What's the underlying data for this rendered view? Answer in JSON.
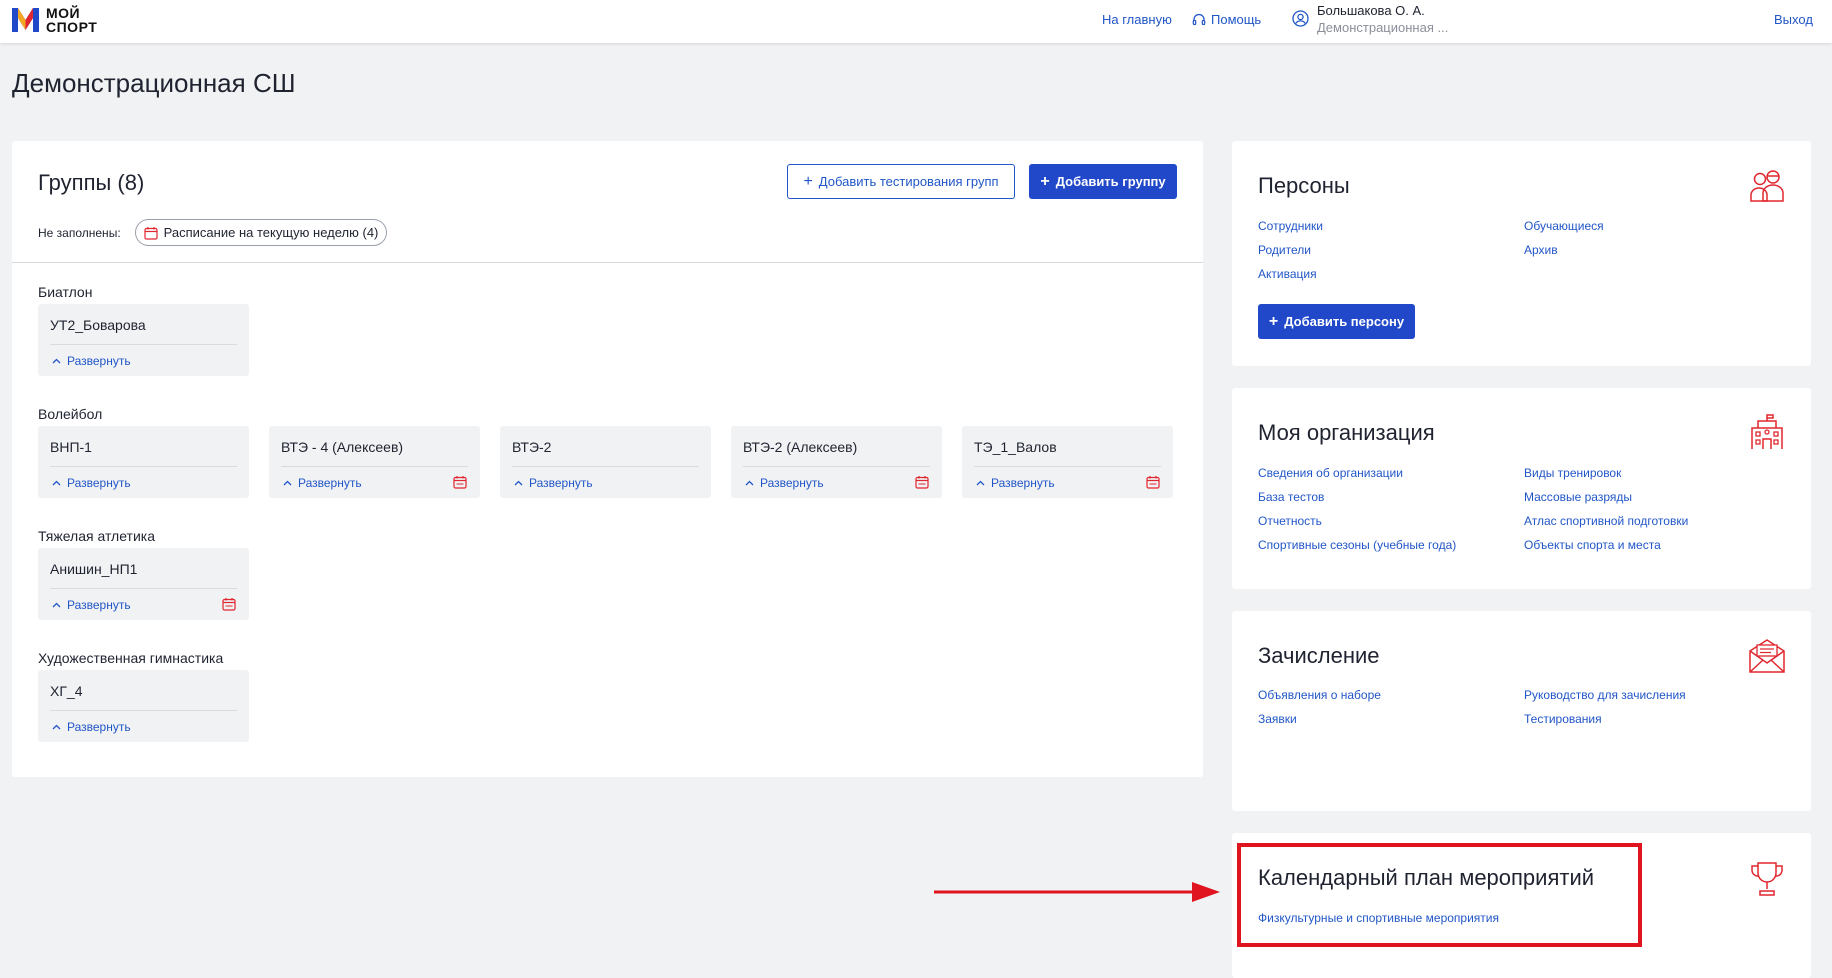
{
  "header": {
    "logo_text_line1": "МОЙ",
    "logo_text_line2": "СПОРТ",
    "nav_home": "На главную",
    "nav_help": "Помощь",
    "user_name": "Большакова О. А.",
    "user_org": "Демонстрационная ...",
    "nav_exit": "Выход"
  },
  "page": {
    "title": "Демонстрационная СШ"
  },
  "groups": {
    "title": "Группы (8)",
    "add_testing_button": "Добавить тестирования групп",
    "add_group_button": "Добавить группу",
    "unfilled_label": "Не заполнены:",
    "unfilled_chip": "Расписание на текущую неделю (4)",
    "expand_label": "Развернуть",
    "sports": [
      {
        "name": "Биатлон",
        "cards": [
          {
            "name": "УТ2_Боварова",
            "calendar": false
          }
        ]
      },
      {
        "name": "Волейбол",
        "cards": [
          {
            "name": "ВНП-1",
            "calendar": false
          },
          {
            "name": "ВТЭ - 4 (Алексеев)",
            "calendar": true
          },
          {
            "name": "ВТЭ-2",
            "calendar": false
          },
          {
            "name": "ВТЭ-2 (Алексеев)",
            "calendar": true
          },
          {
            "name": "ТЭ_1_Валов",
            "calendar": true
          }
        ]
      },
      {
        "name": "Тяжелая атлетика",
        "cards": [
          {
            "name": "Анишин_НП1",
            "calendar": true
          }
        ]
      },
      {
        "name": "Художественная гимнастика",
        "cards": [
          {
            "name": "ХГ_4",
            "calendar": false
          }
        ]
      }
    ]
  },
  "persons": {
    "title": "Персоны",
    "icon": "people-icon",
    "links": [
      "Сотрудники",
      "Обучающиеся",
      "Родители",
      "Архив",
      "Активация"
    ],
    "add_button": "Добавить персону"
  },
  "organization": {
    "title": "Моя организация",
    "icon": "building-icon",
    "links": [
      "Сведения об организации",
      "Виды тренировок",
      "База тестов",
      "Массовые разряды",
      "Отчетность",
      "Атлас спортивной подготовки",
      "Спортивные сезоны (учебные года)",
      "Объекты спорта и места"
    ]
  },
  "enrollment": {
    "title": "Зачисление",
    "icon": "envelope-icon",
    "links": [
      "Объявления о наборе",
      "Руководство для зачисления",
      "Заявки",
      "Тестирования"
    ]
  },
  "events": {
    "title": "Календарный план мероприятий",
    "icon": "trophy-icon",
    "links": [
      "Физкультурные и спортивные мероприятия"
    ]
  },
  "colors": {
    "accent": "#2148c9",
    "link": "#2156c7",
    "icon_red": "#e0262e",
    "highlight": "#e0141e"
  }
}
